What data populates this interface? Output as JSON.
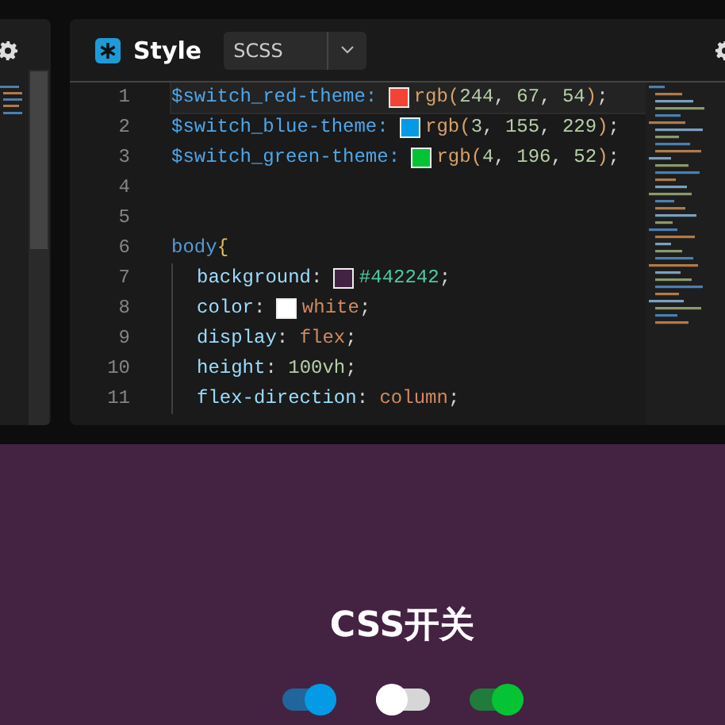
{
  "editor": {
    "title": "Style",
    "language": "SCSS",
    "lines": [
      {
        "number": "1",
        "current": true,
        "indented": false,
        "tokens": [
          {
            "kind": "variable",
            "text": "$switch_red-theme: "
          },
          {
            "kind": "swatch",
            "color": "#f44336"
          },
          {
            "kind": "func",
            "text": "rgb("
          },
          {
            "kind": "number",
            "text": "244"
          },
          {
            "kind": "punct",
            "text": ", "
          },
          {
            "kind": "number",
            "text": "67"
          },
          {
            "kind": "punct",
            "text": ", "
          },
          {
            "kind": "number",
            "text": "54"
          },
          {
            "kind": "func",
            "text": ")"
          },
          {
            "kind": "punct",
            "text": ";"
          }
        ]
      },
      {
        "number": "2",
        "current": false,
        "indented": false,
        "tokens": [
          {
            "kind": "variable",
            "text": "$switch_blue-theme: "
          },
          {
            "kind": "swatch",
            "color": "#039be5"
          },
          {
            "kind": "func",
            "text": "rgb("
          },
          {
            "kind": "number",
            "text": "3"
          },
          {
            "kind": "punct",
            "text": ", "
          },
          {
            "kind": "number",
            "text": "155"
          },
          {
            "kind": "punct",
            "text": ", "
          },
          {
            "kind": "number",
            "text": "229"
          },
          {
            "kind": "func",
            "text": ")"
          },
          {
            "kind": "punct",
            "text": ";"
          }
        ]
      },
      {
        "number": "3",
        "current": false,
        "indented": false,
        "tokens": [
          {
            "kind": "variable",
            "text": "$switch_green-theme: "
          },
          {
            "kind": "swatch",
            "color": "#04c434"
          },
          {
            "kind": "func",
            "text": "rgb("
          },
          {
            "kind": "number",
            "text": "4"
          },
          {
            "kind": "punct",
            "text": ", "
          },
          {
            "kind": "number",
            "text": "196"
          },
          {
            "kind": "punct",
            "text": ", "
          },
          {
            "kind": "number",
            "text": "52"
          },
          {
            "kind": "func",
            "text": ")"
          },
          {
            "kind": "punct",
            "text": ";"
          }
        ]
      },
      {
        "number": "4",
        "current": false,
        "indented": false
      },
      {
        "number": "5",
        "current": false,
        "indented": false
      },
      {
        "number": "6",
        "current": false,
        "indented": false,
        "tokens": [
          {
            "kind": "selector",
            "text": "body"
          },
          {
            "kind": "brace",
            "text": "{"
          }
        ]
      },
      {
        "number": "7",
        "current": false,
        "indented": true,
        "tokens": [
          {
            "kind": "property",
            "text": "background"
          },
          {
            "kind": "punct",
            "text": ": "
          },
          {
            "kind": "swatch",
            "color": "#442242"
          },
          {
            "kind": "hex",
            "text": "#442242"
          },
          {
            "kind": "punct",
            "text": ";"
          }
        ]
      },
      {
        "number": "8",
        "current": false,
        "indented": true,
        "tokens": [
          {
            "kind": "property",
            "text": "color"
          },
          {
            "kind": "punct",
            "text": ": "
          },
          {
            "kind": "swatch",
            "color": "#ffffff"
          },
          {
            "kind": "value",
            "text": "white"
          },
          {
            "kind": "punct",
            "text": ";"
          }
        ]
      },
      {
        "number": "9",
        "current": false,
        "indented": true,
        "tokens": [
          {
            "kind": "property",
            "text": "display"
          },
          {
            "kind": "punct",
            "text": ": "
          },
          {
            "kind": "value",
            "text": "flex"
          },
          {
            "kind": "punct",
            "text": ";"
          }
        ]
      },
      {
        "number": "10",
        "current": false,
        "indented": true,
        "tokens": [
          {
            "kind": "property",
            "text": "height"
          },
          {
            "kind": "punct",
            "text": ": "
          },
          {
            "kind": "number",
            "text": "100vh"
          },
          {
            "kind": "punct",
            "text": ";"
          }
        ]
      },
      {
        "number": "11",
        "current": false,
        "indented": true,
        "tokens": [
          {
            "kind": "property",
            "text": "flex-direction"
          },
          {
            "kind": "punct",
            "text": ": "
          },
          {
            "kind": "value",
            "text": "column"
          },
          {
            "kind": "punct",
            "text": ";"
          }
        ]
      }
    ]
  },
  "preview": {
    "heading": "CSS开关",
    "switches": [
      {
        "on": true,
        "color": "#039be5"
      },
      {
        "on": false
      },
      {
        "on": true,
        "color": "#04c434"
      }
    ]
  }
}
